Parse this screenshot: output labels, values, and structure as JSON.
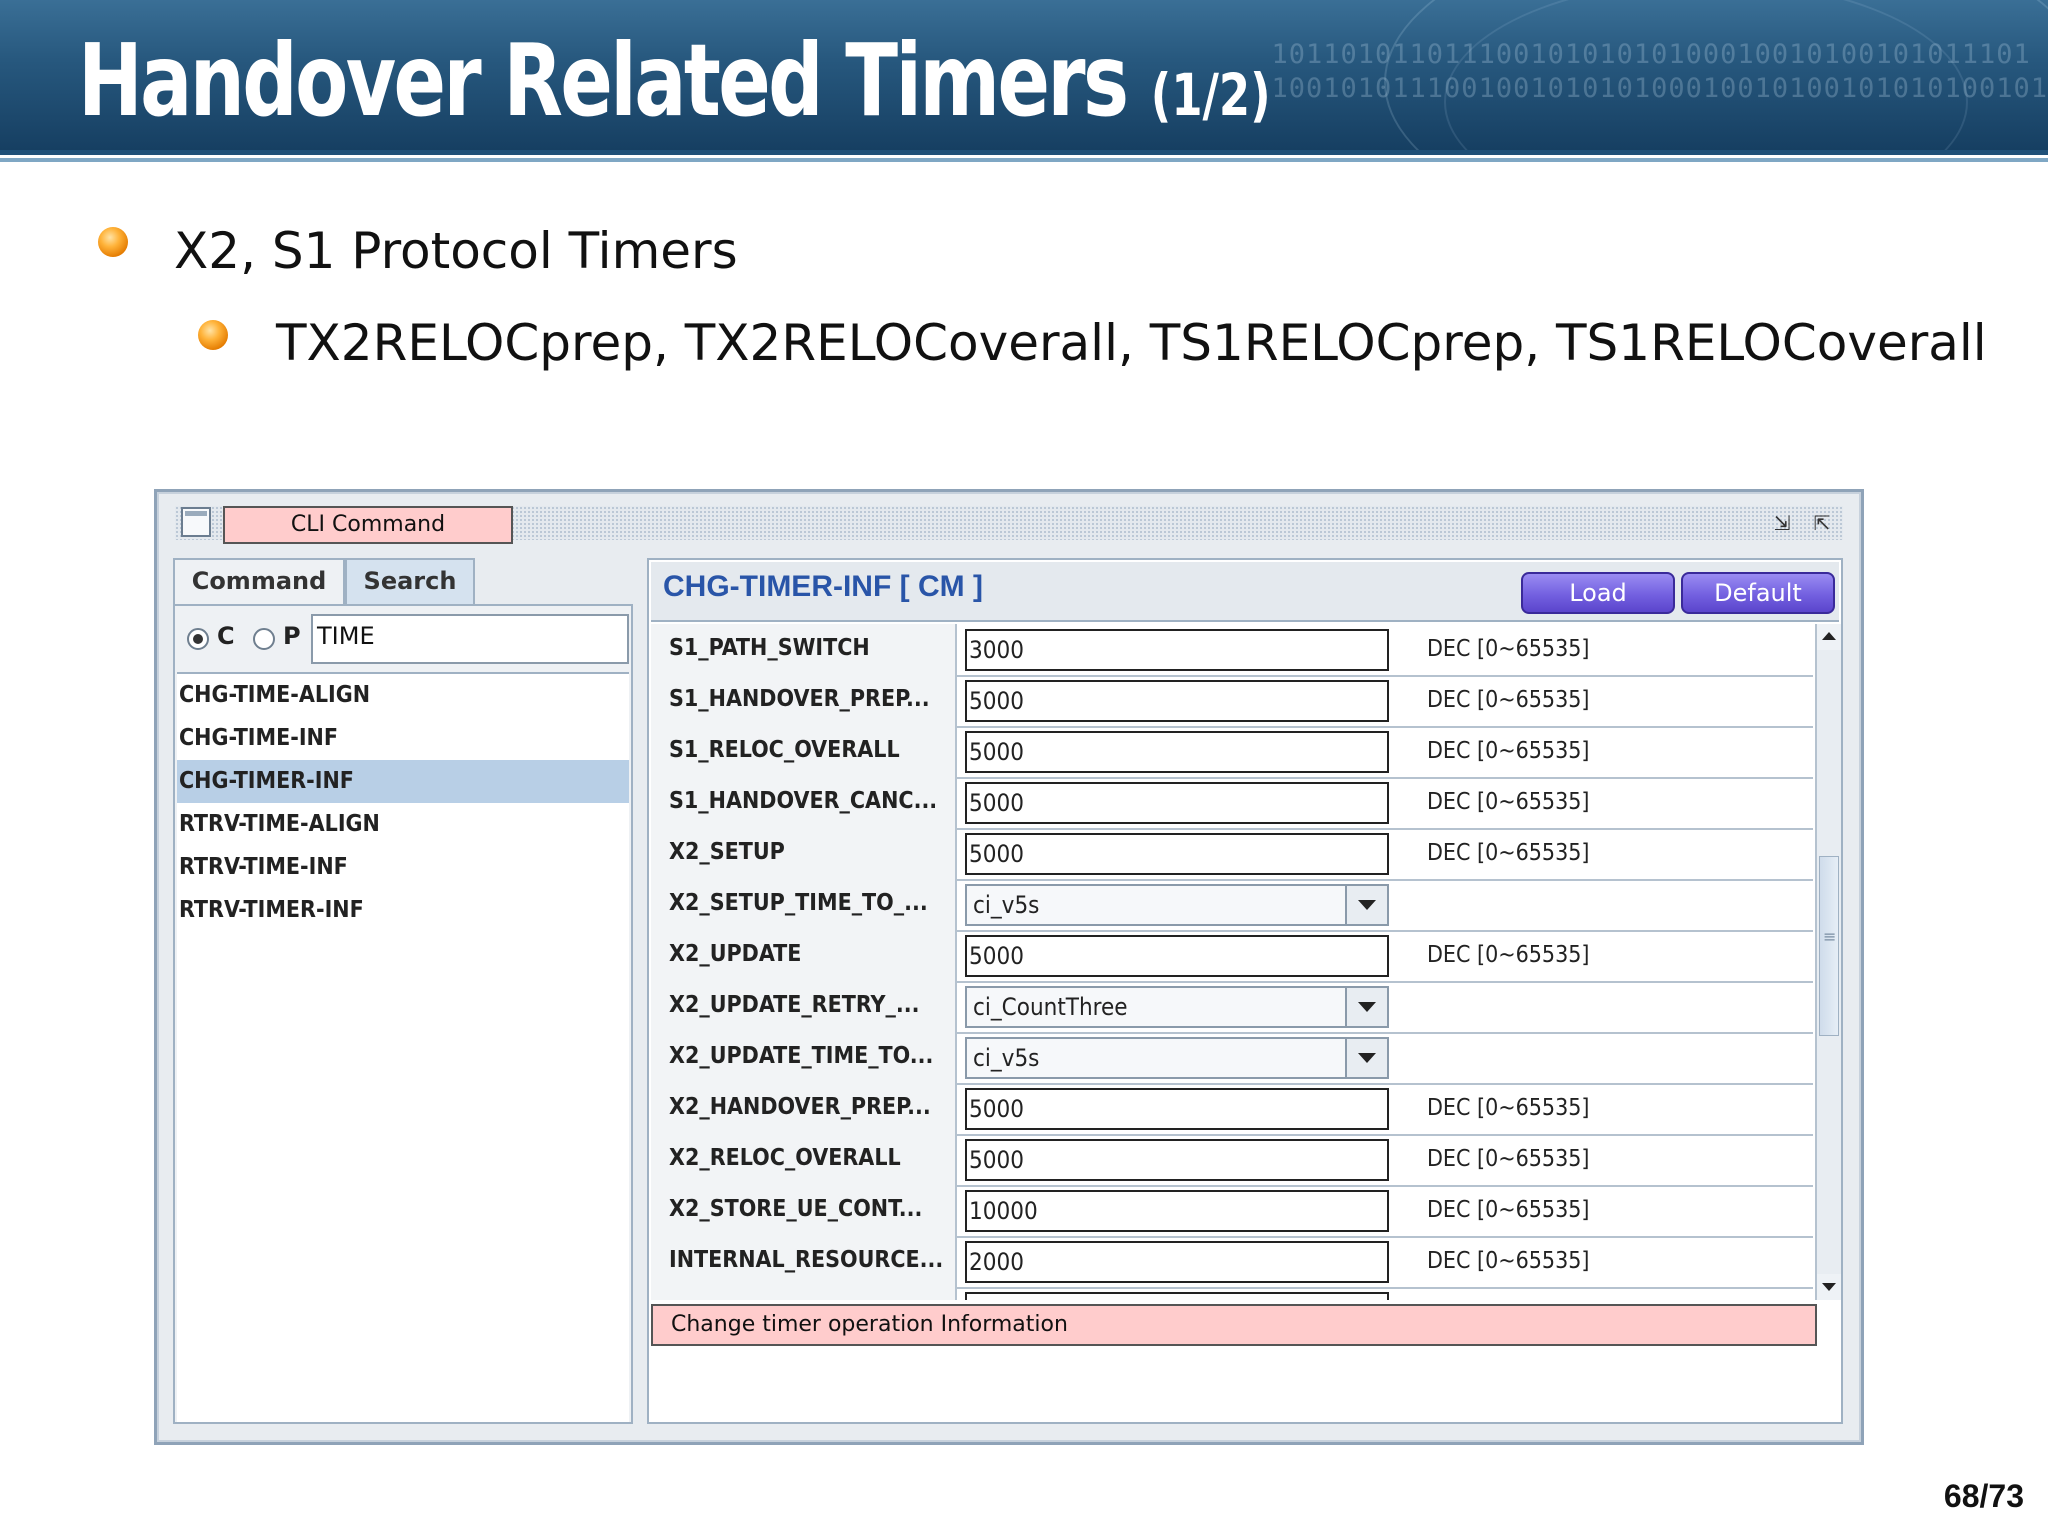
{
  "slide": {
    "title": "Handover Related Timers",
    "title_suffix": "(1/2)",
    "banner_binary_1": "10110101101110010101010100010010100101011101",
    "banner_binary_2": "100101011100100101010100010010100101010100101",
    "bullet1": "X2, S1 Protocol Timers",
    "bullet2": "TX2RELOCprep, TX2RELOCoverall, TS1RELOCprep, TS1RELOCoverall",
    "page_number": "68/73"
  },
  "window": {
    "cli_label": "CLI Command",
    "tabs": [
      {
        "label": "Command",
        "active": false
      },
      {
        "label": "Search",
        "active": true
      }
    ],
    "radio": {
      "option_c": "C",
      "option_p": "P",
      "selected": "C",
      "search_value": "TIME"
    },
    "command_list": [
      {
        "label": "CHG-TIME-ALIGN",
        "selected": false
      },
      {
        "label": "CHG-TIME-INF",
        "selected": false
      },
      {
        "label": "CHG-TIMER-INF",
        "selected": true
      },
      {
        "label": "RTRV-TIME-ALIGN",
        "selected": false
      },
      {
        "label": "RTRV-TIME-INF",
        "selected": false
      },
      {
        "label": "RTRV-TIMER-INF",
        "selected": false
      }
    ],
    "panel_title": "CHG-TIMER-INF [ CM ]",
    "load_label": "Load",
    "default_label": "Default",
    "params": [
      {
        "name": "S1_PATH_SWITCH",
        "type": "input",
        "value": "3000",
        "range": "DEC [0~65535]"
      },
      {
        "name": "S1_HANDOVER_PREP...",
        "type": "input",
        "value": "5000",
        "range": "DEC [0~65535]"
      },
      {
        "name": "S1_RELOC_OVERALL",
        "type": "input",
        "value": "5000",
        "range": "DEC [0~65535]"
      },
      {
        "name": "S1_HANDOVER_CANC...",
        "type": "input",
        "value": "5000",
        "range": "DEC [0~65535]"
      },
      {
        "name": "X2_SETUP",
        "type": "input",
        "value": "5000",
        "range": "DEC [0~65535]"
      },
      {
        "name": "X2_SETUP_TIME_TO_...",
        "type": "select",
        "value": "ci_v5s",
        "range": ""
      },
      {
        "name": "X2_UPDATE",
        "type": "input",
        "value": "5000",
        "range": "DEC [0~65535]"
      },
      {
        "name": "X2_UPDATE_RETRY_...",
        "type": "select",
        "value": "ci_CountThree",
        "range": ""
      },
      {
        "name": "X2_UPDATE_TIME_TO...",
        "type": "select",
        "value": "ci_v5s",
        "range": ""
      },
      {
        "name": "X2_HANDOVER_PREP...",
        "type": "input",
        "value": "5000",
        "range": "DEC [0~65535]"
      },
      {
        "name": "X2_RELOC_OVERALL",
        "type": "input",
        "value": "5000",
        "range": "DEC [0~65535]"
      },
      {
        "name": "X2_STORE_UE_CONT...",
        "type": "input",
        "value": "10000",
        "range": "DEC [0~65535]"
      },
      {
        "name": "INTERNAL_RESOURCE...",
        "type": "input",
        "value": "2000",
        "range": "DEC [0~65535]"
      },
      {
        "name": "",
        "type": "input",
        "value": "",
        "range": ""
      }
    ],
    "description": "Change timer operation Information"
  }
}
